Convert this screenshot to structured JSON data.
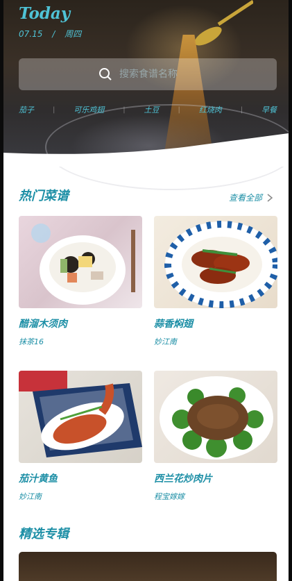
{
  "header": {
    "today": "Today",
    "date": "07.15",
    "slash": "/",
    "weekday": "周四"
  },
  "search": {
    "placeholder": "搜索食谱名称"
  },
  "tags": [
    "茄子",
    "可乐鸡翅",
    "土豆",
    "红烧肉",
    "早餐"
  ],
  "hot": {
    "title": "热门菜谱",
    "view_all": "查看全部",
    "items": [
      {
        "title": "醋溜木须肉",
        "author": "抹茶16"
      },
      {
        "title": "蒜香焖翅",
        "author": "妙江南"
      },
      {
        "title": "茄汁黄鱼",
        "author": "妙江南"
      },
      {
        "title": "西兰花炒肉片",
        "author": "程宝嫁嫁"
      }
    ]
  },
  "featured": {
    "title": "精选专辑"
  },
  "colors": {
    "accent": "#1d8fa6",
    "accent_light": "#4fc3d6",
    "hero_dark": "#2f2a24"
  },
  "icons": {
    "search": "search-icon",
    "chevron": "chevron-right-icon"
  }
}
